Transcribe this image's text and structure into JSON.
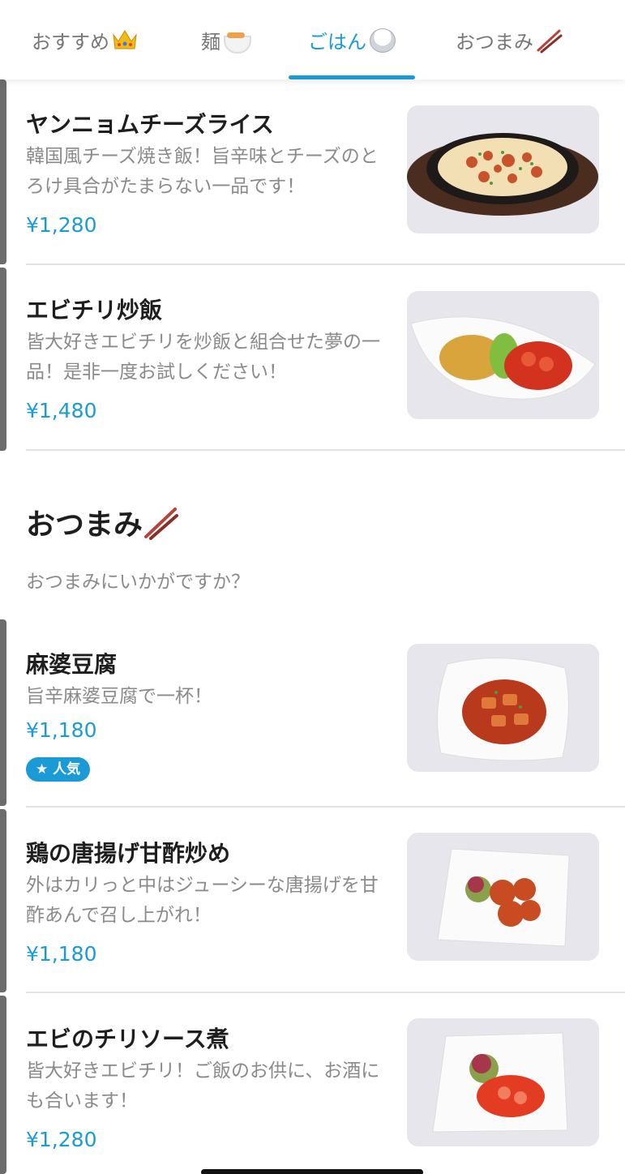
{
  "tabs": [
    {
      "label": "おすすめ",
      "icon": "crown-icon",
      "active": false
    },
    {
      "label": "麺",
      "icon": "ramen-bowl-icon",
      "active": false
    },
    {
      "label": "ごはん",
      "icon": "rice-bowl-icon",
      "active": true
    },
    {
      "label": "おつまみ",
      "icon": "chopsticks-icon",
      "active": false
    }
  ],
  "accent_color": "#1a9bd7",
  "rice_items": [
    {
      "name": "ヤンニョムチーズライス",
      "desc": "韓国風チーズ焼き飯！旨辛味とチーズのとろけ具合がたまらない一品です！",
      "price": "¥1,280"
    },
    {
      "name": "エビチリ炒飯",
      "desc": "皆大好きエビチリを炒飯と組合せた夢の一品！是非一度お試しください！",
      "price": "¥1,480"
    }
  ],
  "section": {
    "title": "おつまみ",
    "icon": "chopsticks-icon",
    "subtitle": "おつまみにいかがですか？"
  },
  "snack_items": [
    {
      "name": "麻婆豆腐",
      "desc": "旨辛麻婆豆腐で一杯！",
      "price": "¥1,180",
      "badge": "人気"
    },
    {
      "name": "鶏の唐揚げ甘酢炒め",
      "desc": "外はカリっと中はジューシーな唐揚げを甘酢あんで召し上がれ！",
      "price": "¥1,180"
    },
    {
      "name": "エビのチリソース煮",
      "desc": "皆大好きエビチリ！ご飯のお供に、お酒にも合います！",
      "price": "¥1,280"
    }
  ]
}
